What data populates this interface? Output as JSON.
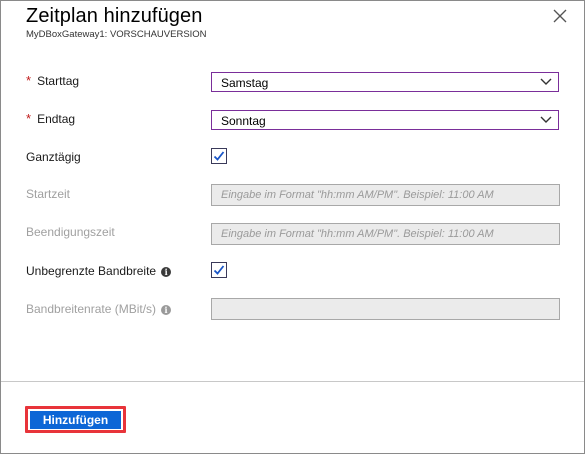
{
  "header": {
    "title": "Zeitplan hinzufügen",
    "subtitle": "MyDBoxGateway1: VORSCHAUVERSION"
  },
  "form": {
    "required_marker": "*",
    "start_day": {
      "label": "Starttag",
      "value": "Samstag"
    },
    "end_day": {
      "label": "Endtag",
      "value": "Sonntag"
    },
    "all_day": {
      "label": "Ganztägig",
      "checked": true
    },
    "start_time": {
      "label": "Startzeit",
      "placeholder": "Eingabe im Format \"hh:mm AM/PM\". Beispiel: 11:00 AM"
    },
    "end_time": {
      "label": "Beendigungszeit",
      "placeholder": "Eingabe im Format \"hh:mm AM/PM\". Beispiel: 11:00 AM"
    },
    "unlimited_bandwidth": {
      "label": "Unbegrenzte Bandbreite",
      "checked": true
    },
    "bandwidth_rate": {
      "label": "Bandbreitenrate (MBit/s)",
      "value": ""
    }
  },
  "footer": {
    "add_label": "Hinzufügen"
  },
  "colors": {
    "accent_border": "#7a2e9a",
    "button_bg": "#0c66d6",
    "highlight": "#e8343a",
    "required": "#c01a1a",
    "check": "#1a56c8"
  },
  "icons": {
    "close": "close-icon",
    "chevron": "chevron-down-icon",
    "check": "checkmark-icon",
    "info": "info-icon"
  }
}
